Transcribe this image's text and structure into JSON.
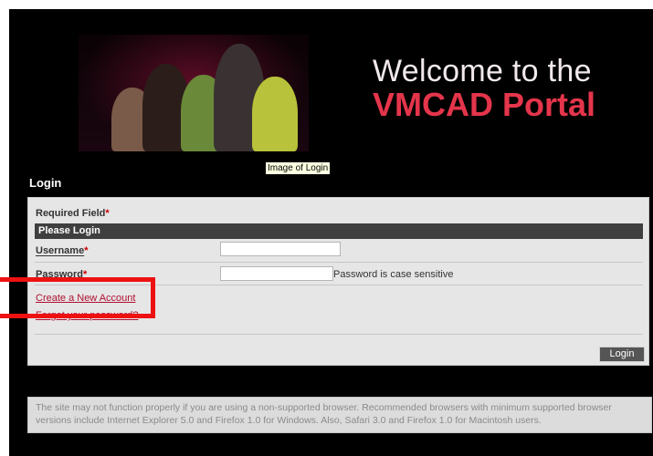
{
  "banner": {
    "title_line1": "Welcome to the",
    "title_line2": "VMCAD Portal",
    "image_caption": "Image of Login"
  },
  "login": {
    "heading": "Login",
    "required_label": "Required Field",
    "asterisk": "*",
    "section_title": "Please Login",
    "username_label": "Username",
    "username_value": "",
    "password_label": "Password",
    "password_value": "",
    "password_hint": "Password is case sensitive",
    "create_account_link": "Create a New Account",
    "forgot_password_link": "Forgot your password?",
    "login_button": "Login"
  },
  "notice": {
    "text": "The site may not function properly if you are using a non-supported browser. Recommended browsers with minimum supported browser versions include Internet Explorer 5.0 and Firefox 1.0 for Windows. Also, Safari 3.0 and Firefox 1.0 for Macintosh users."
  },
  "colors": {
    "page_background": "#000000",
    "brand_red": "#e4354b",
    "link_red": "#b01030",
    "highlight": "#ee1111"
  }
}
